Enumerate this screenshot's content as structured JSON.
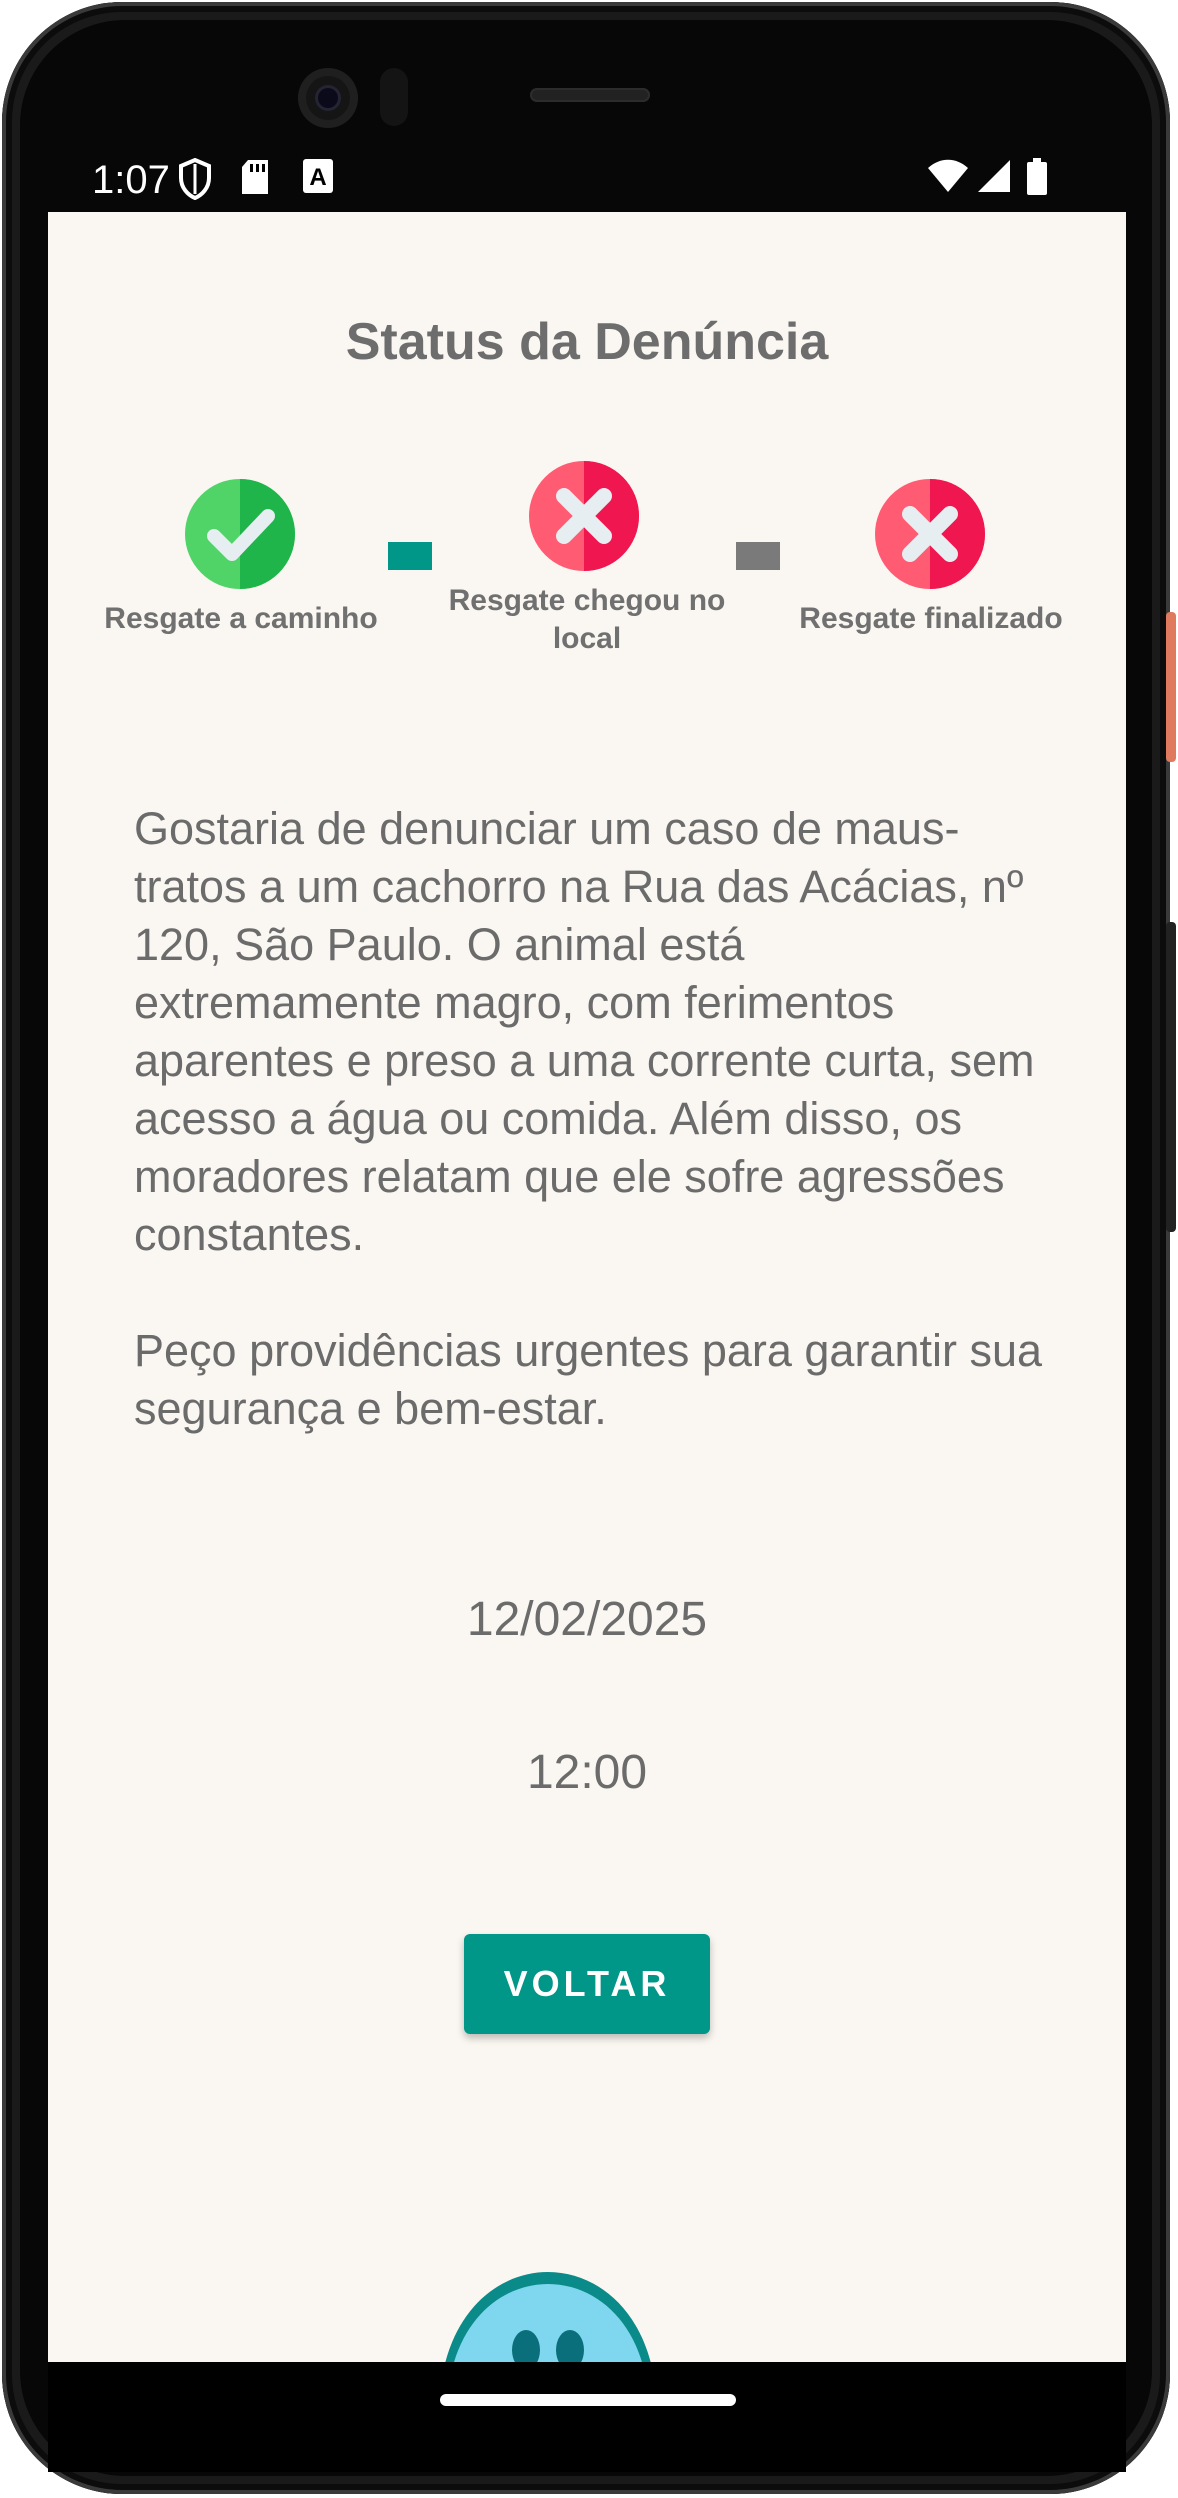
{
  "status_bar": {
    "time": "1:07",
    "left_icons": [
      "shield-icon",
      "sd-card-icon",
      "font-a-icon"
    ],
    "right_icons": [
      "wifi-icon",
      "signal-icon",
      "battery-icon"
    ]
  },
  "page": {
    "title": "Status da Denúncia"
  },
  "steps": [
    {
      "label": "Resgate a caminho",
      "state": "done",
      "icon": "check-circle-icon"
    },
    {
      "label": "Resgate chegou no local",
      "state": "pending",
      "icon": "x-circle-icon"
    },
    {
      "label": "Resgate finalizado",
      "state": "pending",
      "icon": "x-circle-icon"
    }
  ],
  "connectors": [
    {
      "state": "active",
      "color": "#009688"
    },
    {
      "state": "inactive",
      "color": "#7a7a7a"
    }
  ],
  "report": {
    "description": "Gostaria de denunciar um caso de maus-tratos a um cachorro na Rua das Acácias, nº 120, São Paulo. O animal está extremamente magro, com ferimentos aparentes e preso a uma corrente curta, sem acesso a água ou comida. Além disso, os moradores relatam que ele sofre agressões constantes.\n\nPeço providências urgentes para garantir sua segurança e bem-estar.",
    "date": "12/02/2025",
    "time": "12:00"
  },
  "actions": {
    "back_label": "VOLTAR"
  },
  "colors": {
    "accent": "#009688",
    "done": "#2ecc71",
    "pending": "#f0385a",
    "background": "#faf6f1"
  }
}
